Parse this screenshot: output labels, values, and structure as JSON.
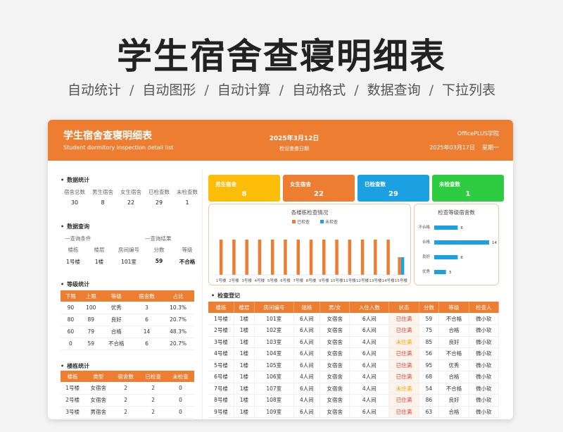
{
  "hero": {
    "title": "学生宿舍查寝明细表",
    "features": [
      "自动统计",
      "自动图形",
      "自动计算",
      "自动格式",
      "数据查询",
      "下拉列表"
    ],
    "separator": "/"
  },
  "header": {
    "title": "学生宿舍查寝明细表",
    "subtitle": "Student dormitory inspection detail list",
    "inspect_date": "2025年3月12日",
    "inspect_date_label": "检设查查日期",
    "brand": "OfficePLUS学院",
    "today": "2025年03月17日",
    "weekday": "星期一"
  },
  "data_stats": {
    "title": "数据统计",
    "headers": [
      "宿舍总数",
      "男生宿舍",
      "女生宿舍",
      "已检查数",
      "未检查数"
    ],
    "values": [
      "30",
      "8",
      "22",
      "29",
      "1"
    ]
  },
  "data_query": {
    "title": "数据查询",
    "cond_label": "—查询条件",
    "result_label": "—查询结果",
    "headers": [
      "楼栋",
      "楼层",
      "房间编号",
      "分数",
      "等级"
    ],
    "values": [
      "1号楼",
      "1楼",
      "101室",
      "59",
      "不合格"
    ]
  },
  "grade_stats": {
    "title": "等级统计",
    "headers": [
      "下限",
      "上限",
      "等级",
      "宿舍数",
      "占比"
    ],
    "rows": [
      [
        "90",
        "100",
        "优秀",
        "3",
        "10.3%"
      ],
      [
        "80",
        "89",
        "良好",
        "6",
        "20.7%"
      ],
      [
        "60",
        "79",
        "合格",
        "14",
        "48.3%"
      ],
      [
        "0",
        "59",
        "不合格",
        "6",
        "20.7%"
      ]
    ]
  },
  "building_stats": {
    "title": "楼栋统计",
    "headers": [
      "楼栋",
      "类型",
      "宿舍数",
      "已检查",
      "未检查"
    ],
    "rows": [
      [
        "1号楼",
        "女宿舍",
        "2",
        "2",
        "0"
      ],
      [
        "2号楼",
        "女宿舍",
        "2",
        "2",
        "0"
      ],
      [
        "3号楼",
        "男宿舍",
        "2",
        "2",
        "0"
      ]
    ]
  },
  "kpis": [
    {
      "label": "男生宿舍",
      "value": "8",
      "color": "#fbbd08"
    },
    {
      "label": "女生宿舍",
      "value": "22",
      "color": "#ec7d31"
    },
    {
      "label": "已检查数",
      "value": "29",
      "color": "#1ba1e2"
    },
    {
      "label": "未检查数",
      "value": "1",
      "color": "#2ecc40"
    }
  ],
  "colors": {
    "accent": "#ec7d31",
    "blue": "#1ba1e2",
    "bar_blue": "#1ba1e2",
    "fail": "#e53935",
    "warn": "#f4a300"
  },
  "chart_data": [
    {
      "type": "bar",
      "title": "各楼栋检查情况",
      "categories": [
        "1号楼",
        "2号楼",
        "3号楼",
        "4号楼",
        "5号楼",
        "6号楼",
        "7号楼",
        "8号楼",
        "9号楼",
        "10号楼",
        "11号楼",
        "12号楼",
        "13号楼",
        "14号楼",
        "15号楼"
      ],
      "series": [
        {
          "name": "已检查",
          "values": [
            2,
            2,
            2,
            2,
            2,
            2,
            2,
            2,
            2,
            2,
            2,
            2,
            2,
            2,
            1
          ]
        },
        {
          "name": "未检查",
          "values": [
            0,
            0,
            0,
            0,
            0,
            0,
            0,
            0,
            0,
            0,
            0,
            0,
            0,
            0,
            1
          ]
        }
      ],
      "ylim": [
        0,
        2
      ],
      "legend": "top-center"
    },
    {
      "type": "bar",
      "orientation": "horizontal",
      "title": "检查等级宿舍数",
      "categories": [
        "不合格",
        "合格",
        "良好",
        "优秀"
      ],
      "values": [
        6,
        14,
        6,
        3
      ],
      "xlim": [
        0,
        14
      ]
    }
  ],
  "register": {
    "title": "检查登记",
    "headers": [
      "楼栋",
      "楼层",
      "房间编号",
      "规格",
      "男/女",
      "入住人数",
      "状态",
      "分数",
      "等级",
      "检查人"
    ],
    "rows": [
      [
        "1号楼",
        "1楼",
        "101室",
        "6人间",
        "女宿舍",
        "6人间",
        "已住满",
        "59",
        "不合格",
        "微小软"
      ],
      [
        "2号楼",
        "1楼",
        "102室",
        "6人间",
        "女宿舍",
        "6人间",
        "已住满",
        "75",
        "合格",
        "微小软"
      ],
      [
        "3号楼",
        "1楼",
        "103室",
        "6人间",
        "女宿舍",
        "4人间",
        "未住满",
        "85",
        "良好",
        "微小软"
      ],
      [
        "4号楼",
        "1楼",
        "104室",
        "6人间",
        "女宿舍",
        "6人间",
        "已住满",
        "56",
        "不合格",
        "微小软"
      ],
      [
        "5号楼",
        "1楼",
        "105室",
        "6人间",
        "女宿舍",
        "6人间",
        "已住满",
        "95",
        "优秀",
        "微小软"
      ],
      [
        "6号楼",
        "1楼",
        "106室",
        "4人间",
        "女宿舍",
        "4人间",
        "已住满",
        "68",
        "合格",
        "微小软"
      ],
      [
        "7号楼",
        "1楼",
        "107室",
        "6人间",
        "女宿舍",
        "4人间",
        "未住满",
        "54",
        "不合格",
        "微小软"
      ],
      [
        "8号楼",
        "1楼",
        "108室",
        "4人间",
        "女宿舍",
        "4人间",
        "已住满",
        "86",
        "良好",
        "微小软"
      ],
      [
        "9号楼",
        "1楼",
        "109室",
        "6人间",
        "女宿舍",
        "6人间",
        "已住满",
        "63",
        "合格",
        "微小软"
      ]
    ]
  }
}
